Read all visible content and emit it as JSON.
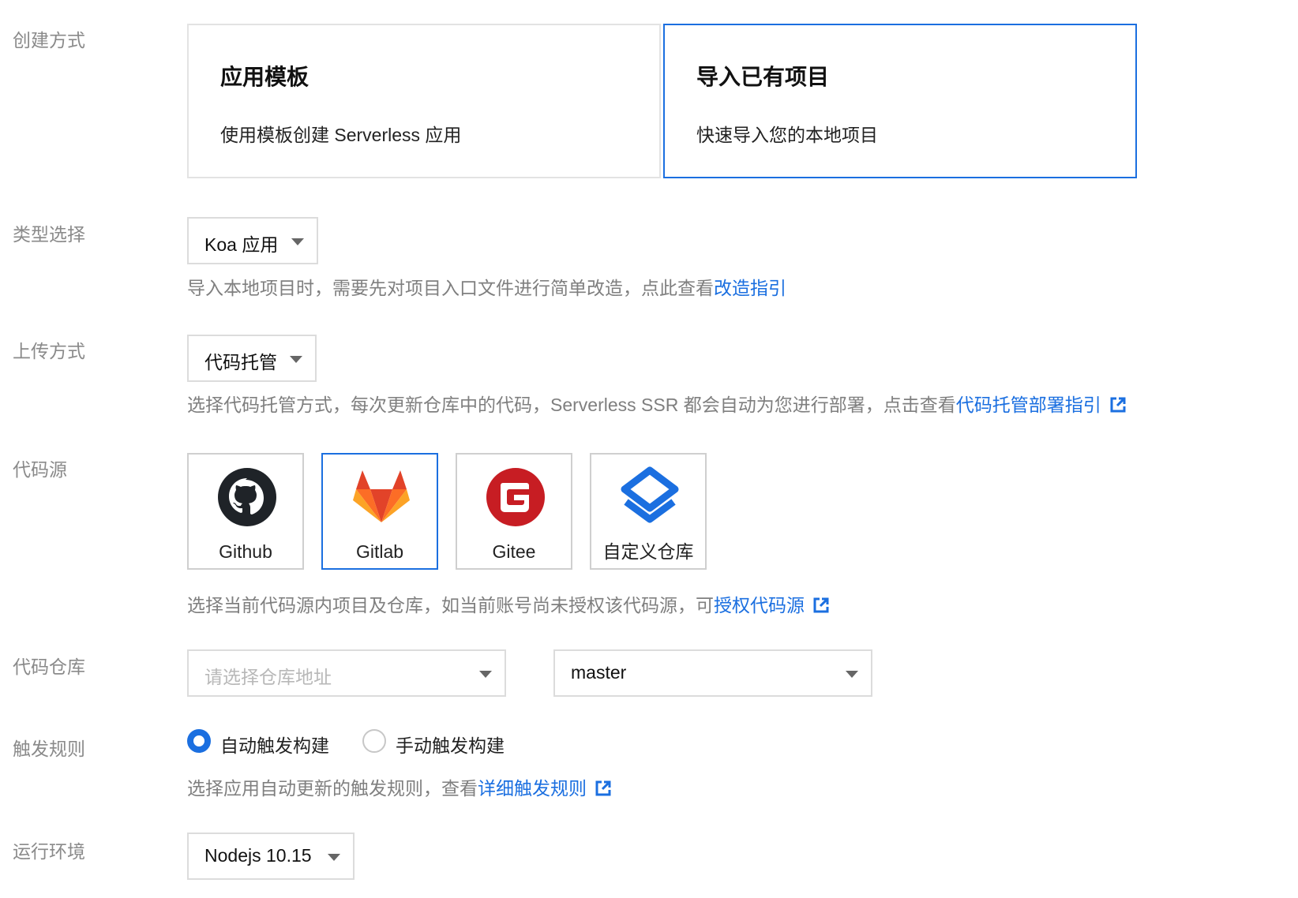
{
  "labels": {
    "create_method": "创建方式",
    "type_select": "类型选择",
    "upload_method": "上传方式",
    "code_source": "代码源",
    "code_repo": "代码仓库",
    "trigger_rule": "触发规则",
    "runtime": "运行环境"
  },
  "create_cards": [
    {
      "title": "应用模板",
      "desc": "使用模板创建 Serverless 应用",
      "selected": false
    },
    {
      "title": "导入已有项目",
      "desc": "快速导入您的本地项目",
      "selected": true
    }
  ],
  "type_select": {
    "value": "Koa 应用",
    "help": "导入本地项目时，需要先对项目入口文件进行简单改造，点此查看",
    "help_link": "改造指引"
  },
  "upload_method": {
    "value": "代码托管",
    "help": "选择代码托管方式，每次更新仓库中的代码，Serverless SSR 都会自动为您进行部署，点击查看",
    "help_link": "代码托管部署指引"
  },
  "code_source": {
    "items": [
      {
        "label": "Github",
        "icon": "github-icon",
        "selected": false
      },
      {
        "label": "Gitlab",
        "icon": "gitlab-icon",
        "selected": true
      },
      {
        "label": "Gitee",
        "icon": "gitee-icon",
        "selected": false
      },
      {
        "label": "自定义仓库",
        "icon": "custom-repo-icon",
        "selected": false
      }
    ],
    "help": "选择当前代码源内项目及仓库，如当前账号尚未授权该代码源，可",
    "help_link": "授权代码源"
  },
  "code_repo": {
    "repo_placeholder": "请选择仓库地址",
    "branch_value": "master"
  },
  "trigger_rule": {
    "options": [
      {
        "label": "自动触发构建",
        "checked": true
      },
      {
        "label": "手动触发构建",
        "checked": false
      }
    ],
    "help": "选择应用自动更新的触发规则，查看",
    "help_link": "详细触发规则"
  },
  "runtime": {
    "value": "Nodejs 10.15"
  },
  "colors": {
    "accent": "#1b6fe0",
    "border": "#dcdcdc",
    "label": "#8a8a8a"
  }
}
